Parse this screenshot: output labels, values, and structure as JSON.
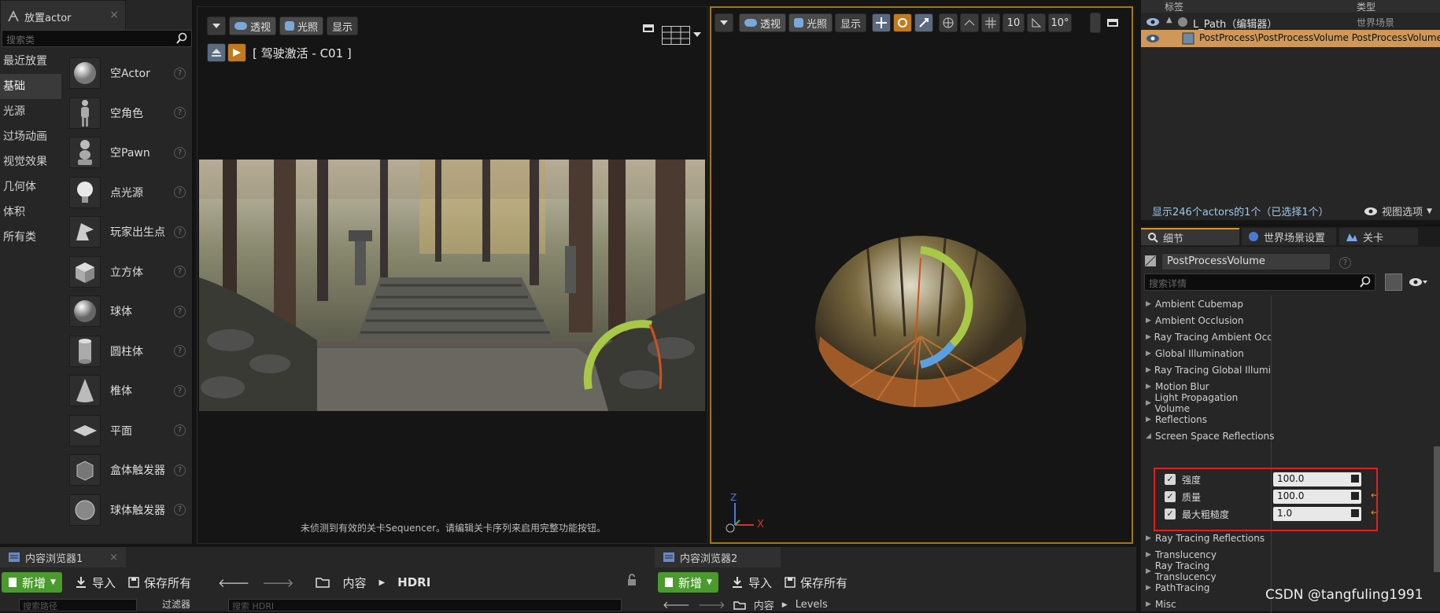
{
  "place_panel": {
    "tab_title": "放置actor",
    "search_placeholder": "搜索类",
    "categories": [
      "最近放置",
      "基础",
      "光源",
      "过场动画",
      "视觉效果",
      "几何体",
      "体积",
      "所有类"
    ],
    "actors": [
      "空Actor",
      "空角色",
      "空Pawn",
      "点光源",
      "玩家出生点",
      "立方体",
      "球体",
      "圆柱体",
      "椎体",
      "平面",
      "盒体触发器",
      "球体触发器"
    ],
    "help_glyph": "?"
  },
  "viewport1": {
    "perspective_label": "透视",
    "lit_label": "光照",
    "show_label": "显示",
    "cine_title": "[ 驾驶激活 - C01 ]",
    "message": "未侦测到有效的关卡Sequencer。请编辑关卡序列来启用完整功能按钮。"
  },
  "viewport2": {
    "perspective_label": "透视",
    "lit_label": "光照",
    "show_label": "显示",
    "grid_snap": "10",
    "rot_snap": "10°",
    "axis_z": "Z",
    "axis_x": "X"
  },
  "outliner": {
    "col_label": "标签",
    "col_type": "类型",
    "row1_name": "L_Path（编辑器）",
    "row1_type": "世界场景",
    "row2_name": "PostProcess\\PostProcessVolume PostProcessVolume",
    "status": "显示246个actors的1个（已选择1个）",
    "view_options": "视图选项"
  },
  "details": {
    "tab_details": "细节",
    "tab_world": "世界场景设置",
    "tab_level": "关卡",
    "object_name": "PostProcessVolume",
    "search_placeholder": "搜索详情",
    "sections": [
      "Ambient Cubemap",
      "Ambient Occlusion",
      "Ray Tracing Ambient Occlus",
      "Global Illumination",
      "Ray Tracing Global Illumina",
      "Motion Blur",
      "Light Propagation Volume",
      "Reflections",
      "Screen Space Reflections"
    ],
    "ssr_props": [
      {
        "label": "强度",
        "value": "100.0"
      },
      {
        "label": "质量",
        "value": "100.0"
      },
      {
        "label": "最大粗糙度",
        "value": "1.0"
      }
    ],
    "sections_after": [
      "Ray Tracing Reflections",
      "Translucency",
      "Ray Tracing Translucency",
      "PathTracing",
      "Misc"
    ]
  },
  "content_browser1": {
    "tab": "内容浏览器1",
    "new_label": "新增",
    "import_label": "导入",
    "save_all_label": "保存所有",
    "path_root": "内容",
    "path_folder": "HDRI",
    "search_paths": "搜索路径",
    "filter_label": "过滤器",
    "search_assets": "搜索 HDRI"
  },
  "content_browser2": {
    "tab": "内容浏览器2",
    "new_label": "新增",
    "import_label": "导入",
    "save_all_label": "保存所有",
    "path_root": "内容",
    "path_folder": "Levels"
  },
  "watermark": "CSDN @tangfuling1991",
  "colors": {
    "accent_orange": "#d89430",
    "selected_row": "#d09858",
    "new_button_green": "#4a9a2c",
    "highlight_red": "#e02020"
  }
}
